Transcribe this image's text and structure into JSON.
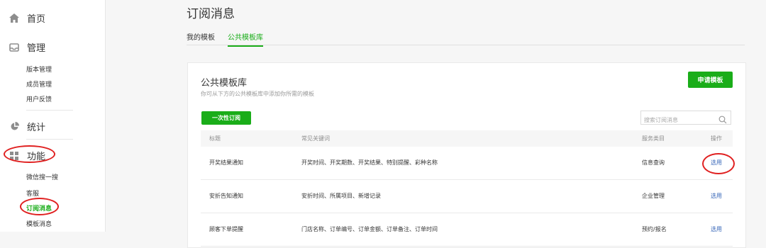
{
  "sidebar": {
    "home": "首页",
    "manage": "管理",
    "manage_items": [
      "版本管理",
      "成员管理",
      "用户反馈"
    ],
    "stats": "统计",
    "features": "功能",
    "feature_items": [
      "微信搜一搜",
      "客服",
      "订阅消息",
      "模板消息"
    ],
    "active_item": "订阅消息"
  },
  "main": {
    "title": "订阅消息",
    "tabs": [
      "我的模板",
      "公共模板库"
    ],
    "active_tab": "公共模板库"
  },
  "card": {
    "title": "公共模板库",
    "subtitle": "你可从下方的公共模板库中添加你所需的模板",
    "apply_button": "申请模板",
    "once_button": "一次性订阅",
    "search_placeholder": "搜索订阅消息"
  },
  "table": {
    "headers": [
      "标题",
      "常见关键词",
      "服务类目",
      "操作"
    ],
    "rows": [
      {
        "title": "开奖结果通知",
        "keywords": "开奖时间、开奖期数、开奖结果、特别提醒、彩种名称",
        "category": "信息查询",
        "action": "选用"
      },
      {
        "title": "安折告知通知",
        "keywords": "安折时间、所属项目、新增记录",
        "category": "企业管理",
        "action": "选用"
      },
      {
        "title": "顾客下单提醒",
        "keywords": "门店名称、订单编号、订单金额、订单备注、订单时间",
        "category": "预约/报名",
        "action": "选用"
      }
    ]
  },
  "colors": {
    "accent": "#1aad19",
    "link": "#3a68b9",
    "annotation": "#e02020"
  }
}
